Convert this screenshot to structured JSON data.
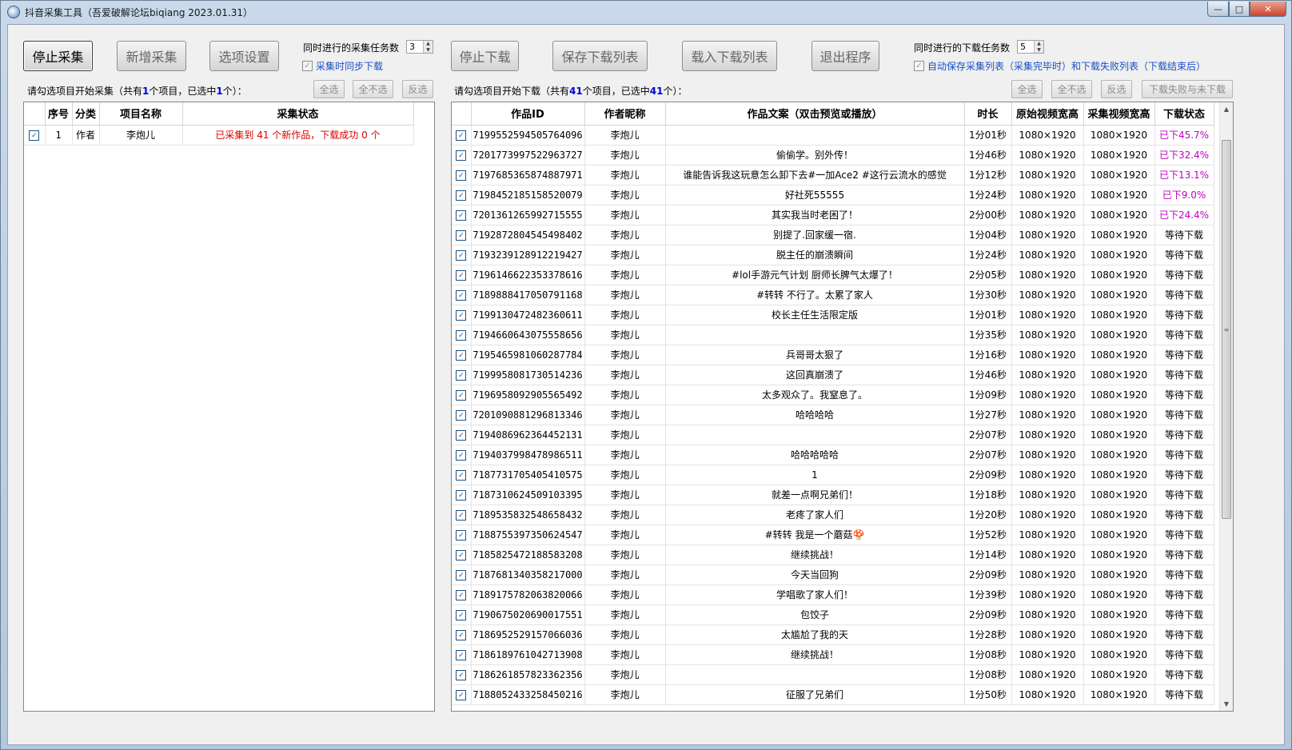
{
  "window": {
    "title": "抖音采集工具（吾爱破解论坛biqiang 2023.01.31）",
    "controls": {
      "minimize": "—",
      "maximize": "□",
      "close": "✕"
    }
  },
  "toolbar": {
    "stop_collect": "停止采集",
    "new_collect": "新增采集",
    "options": "选项设置",
    "collect_tasks_label": "同时进行的采集任务数",
    "collect_tasks_value": "3",
    "sync_download_label": "采集时同步下载",
    "stop_download": "停止下载",
    "save_list": "保存下载列表",
    "load_list": "载入下载列表",
    "exit": "退出程序",
    "download_tasks_label": "同时进行的下载任务数",
    "download_tasks_value": "5",
    "auto_save_label": "自动保存采集列表（采集完毕时）和下载失败列表（下载结束后）"
  },
  "left": {
    "hint_prefix": "请勾选项目开始采集（共有",
    "total": "1",
    "hint_middle": "个项目，已选中",
    "selected": "1",
    "hint_suffix": "个）：",
    "buttons": {
      "select_all": "全选",
      "select_none": "全不选",
      "invert": "反选"
    },
    "headers": [
      "序号",
      "分类",
      "项目名称",
      "采集状态"
    ],
    "rows": [
      {
        "checked": true,
        "index": "1",
        "category": "作者",
        "name": "李炮儿",
        "status": "已采集到 41 个新作品，下载成功 0 个"
      }
    ]
  },
  "right": {
    "hint_prefix": "请勾选项目开始下载（共有",
    "total": "41",
    "hint_middle": "个项目，已选中",
    "selected": "41",
    "hint_suffix": "个）：",
    "buttons": {
      "select_all": "全选",
      "select_none": "全不选",
      "invert": "反选",
      "failed": "下载失败与未下载"
    },
    "headers": [
      "作品ID",
      "作者昵称",
      "作品文案（双击预览或播放）",
      "时长",
      "原始视频宽高",
      "采集视频宽高",
      "下载状态"
    ],
    "rows": [
      {
        "id": "7199552594505764096",
        "author": "李炮儿",
        "text": "",
        "duration": "1分01秒",
        "orig": "1080×1920",
        "coll": "1080×1920",
        "status": "已下45.7%",
        "active": true
      },
      {
        "id": "7201773997522963727",
        "author": "李炮儿",
        "text": "偷偷学。别外传！",
        "duration": "1分46秒",
        "orig": "1080×1920",
        "coll": "1080×1920",
        "status": "已下32.4%",
        "active": true
      },
      {
        "id": "7197685365874887971",
        "author": "李炮儿",
        "text": "谁能告诉我这玩意怎么卸下去#一加Ace2 #这行云流水的感觉",
        "duration": "1分12秒",
        "orig": "1080×1920",
        "coll": "1080×1920",
        "status": "已下13.1%",
        "active": true
      },
      {
        "id": "7198452185158520079",
        "author": "李炮儿",
        "text": "好社死55555",
        "duration": "1分24秒",
        "orig": "1080×1920",
        "coll": "1080×1920",
        "status": "已下9.0%",
        "active": true
      },
      {
        "id": "7201361265992715555",
        "author": "李炮儿",
        "text": "其实我当时老困了！",
        "duration": "2分00秒",
        "orig": "1080×1920",
        "coll": "1080×1920",
        "status": "已下24.4%",
        "active": true
      },
      {
        "id": "7192872804545498402",
        "author": "李炮儿",
        "text": "别提了.回家缓一宿.",
        "duration": "1分04秒",
        "orig": "1080×1920",
        "coll": "1080×1920",
        "status": "等待下载",
        "active": false
      },
      {
        "id": "7193239128912219427",
        "author": "李炮儿",
        "text": "脱主任的崩溃瞬间",
        "duration": "1分24秒",
        "orig": "1080×1920",
        "coll": "1080×1920",
        "status": "等待下载",
        "active": false
      },
      {
        "id": "7196146622353378616",
        "author": "李炮儿",
        "text": "#lol手游元气计划 厨师长脾气太爆了！",
        "duration": "2分05秒",
        "orig": "1080×1920",
        "coll": "1080×1920",
        "status": "等待下载",
        "active": false
      },
      {
        "id": "7189888417050791168",
        "author": "李炮儿",
        "text": "#转转 不行了。太累了家人",
        "duration": "1分30秒",
        "orig": "1080×1920",
        "coll": "1080×1920",
        "status": "等待下载",
        "active": false
      },
      {
        "id": "7199130472482360611",
        "author": "李炮儿",
        "text": "校长主任生活限定版",
        "duration": "1分01秒",
        "orig": "1080×1920",
        "coll": "1080×1920",
        "status": "等待下载",
        "active": false
      },
      {
        "id": "7194660643075558656",
        "author": "李炮儿",
        "text": "",
        "duration": "1分35秒",
        "orig": "1080×1920",
        "coll": "1080×1920",
        "status": "等待下载",
        "active": false
      },
      {
        "id": "7195465981060287784",
        "author": "李炮儿",
        "text": "兵哥哥太狠了",
        "duration": "1分16秒",
        "orig": "1080×1920",
        "coll": "1080×1920",
        "status": "等待下载",
        "active": false
      },
      {
        "id": "7199958081730514236",
        "author": "李炮儿",
        "text": "这回真崩溃了",
        "duration": "1分46秒",
        "orig": "1080×1920",
        "coll": "1080×1920",
        "status": "等待下载",
        "active": false
      },
      {
        "id": "7196958092905565492",
        "author": "李炮儿",
        "text": "太多观众了。我窒息了。",
        "duration": "1分09秒",
        "orig": "1080×1920",
        "coll": "1080×1920",
        "status": "等待下载",
        "active": false
      },
      {
        "id": "7201090881296813346",
        "author": "李炮儿",
        "text": "哈哈哈哈",
        "duration": "1分27秒",
        "orig": "1080×1920",
        "coll": "1080×1920",
        "status": "等待下载",
        "active": false
      },
      {
        "id": "7194086962364452131",
        "author": "李炮儿",
        "text": "",
        "duration": "2分07秒",
        "orig": "1080×1920",
        "coll": "1080×1920",
        "status": "等待下载",
        "active": false
      },
      {
        "id": "7194037998478986511",
        "author": "李炮儿",
        "text": "哈哈哈哈哈",
        "duration": "2分07秒",
        "orig": "1080×1920",
        "coll": "1080×1920",
        "status": "等待下载",
        "active": false
      },
      {
        "id": "7187731705405410575",
        "author": "李炮儿",
        "text": "1",
        "duration": "2分09秒",
        "orig": "1080×1920",
        "coll": "1080×1920",
        "status": "等待下载",
        "active": false
      },
      {
        "id": "7187310624509103395",
        "author": "李炮儿",
        "text": "就差一点啊兄弟们！",
        "duration": "1分18秒",
        "orig": "1080×1920",
        "coll": "1080×1920",
        "status": "等待下载",
        "active": false
      },
      {
        "id": "7189535832548658432",
        "author": "李炮儿",
        "text": "老疼了家人们",
        "duration": "1分20秒",
        "orig": "1080×1920",
        "coll": "1080×1920",
        "status": "等待下载",
        "active": false
      },
      {
        "id": "7188755397350624547",
        "author": "李炮儿",
        "text": "#转转 我是一个蘑菇🍄",
        "duration": "1分52秒",
        "orig": "1080×1920",
        "coll": "1080×1920",
        "status": "等待下载",
        "active": false
      },
      {
        "id": "7185825472188583208",
        "author": "李炮儿",
        "text": "继续挑战！",
        "duration": "1分14秒",
        "orig": "1080×1920",
        "coll": "1080×1920",
        "status": "等待下载",
        "active": false
      },
      {
        "id": "7187681340358217000",
        "author": "李炮儿",
        "text": "今天当回狗",
        "duration": "2分09秒",
        "orig": "1080×1920",
        "coll": "1080×1920",
        "status": "等待下载",
        "active": false
      },
      {
        "id": "7189175782063820066",
        "author": "李炮儿",
        "text": "学唱歌了家人们！",
        "duration": "1分39秒",
        "orig": "1080×1920",
        "coll": "1080×1920",
        "status": "等待下载",
        "active": false
      },
      {
        "id": "7190675020690017551",
        "author": "李炮儿",
        "text": "包饺子",
        "duration": "2分09秒",
        "orig": "1080×1920",
        "coll": "1080×1920",
        "status": "等待下载",
        "active": false
      },
      {
        "id": "7186952529157066036",
        "author": "李炮儿",
        "text": "太尴尬了我的天",
        "duration": "1分28秒",
        "orig": "1080×1920",
        "coll": "1080×1920",
        "status": "等待下载",
        "active": false
      },
      {
        "id": "7186189761042713908",
        "author": "李炮儿",
        "text": "继续挑战！",
        "duration": "1分08秒",
        "orig": "1080×1920",
        "coll": "1080×1920",
        "status": "等待下载",
        "active": false
      },
      {
        "id": "7186261857823362356",
        "author": "李炮儿",
        "text": "",
        "duration": "1分08秒",
        "orig": "1080×1920",
        "coll": "1080×1920",
        "status": "等待下载",
        "active": false
      },
      {
        "id": "7188052433258450216",
        "author": "李炮儿",
        "text": "征服了兄弟们",
        "duration": "1分50秒",
        "orig": "1080×1920",
        "coll": "1080×1920",
        "status": "等待下载",
        "active": false
      }
    ]
  },
  "colors": {
    "progress": "#c000c0",
    "collect_status": "#e00000",
    "highlight": "#0000e0",
    "link": "#1a4fc8"
  },
  "icons": {
    "app": "app-icon",
    "checkbox": "check-icon",
    "scroll_up": "arrow-up-icon",
    "scroll_down": "arrow-down-icon"
  }
}
